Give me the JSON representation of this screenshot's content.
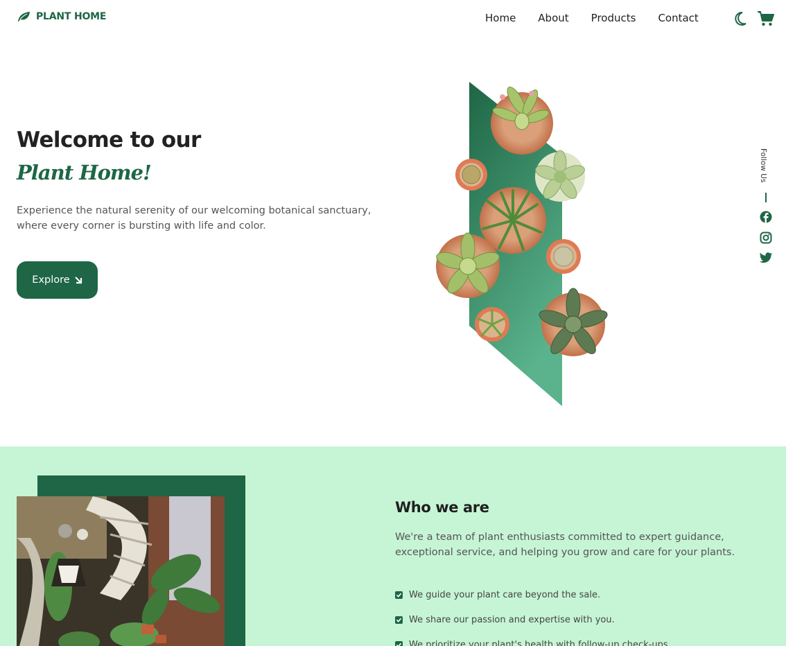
{
  "header": {
    "logo_text": "PLANT HOME",
    "logo_icon": "leaf-icon",
    "nav": [
      "Home",
      "About",
      "Products",
      "Contact"
    ],
    "theme_icon": "moon-icon",
    "cart_icon": "cart-icon"
  },
  "hero": {
    "title": "Welcome to our",
    "subtitle": "Plant Home!",
    "description": "Experience the natural serenity of our welcoming botanical sanctuary, where every corner is bursting with life and color.",
    "explore_label": "Explore",
    "explore_icon": "arrow-down-right-icon"
  },
  "follow": {
    "label": "Follow Us",
    "icons": [
      "facebook-icon",
      "instagram-icon",
      "twitter-icon"
    ]
  },
  "about": {
    "title": "Who we are",
    "description": "We're a team of plant enthusiasts committed to expert guidance, exceptional service, and helping you grow and care for your plants.",
    "points": [
      "We guide your plant care beyond the sale.",
      "We share our passion and expertise with you.",
      "We prioritize your plant's health with follow-up check-ups."
    ]
  },
  "colors": {
    "primary": "#1e6645",
    "section_bg": "#c6f5d5",
    "gradient_light": "#5ab38c"
  }
}
